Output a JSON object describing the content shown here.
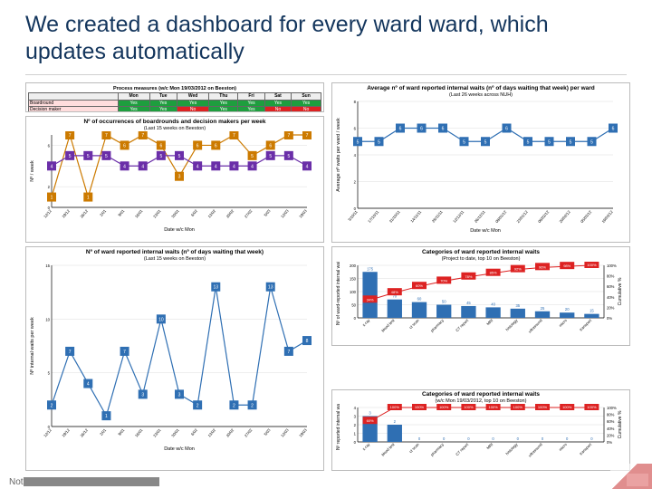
{
  "title": "We created a dashboard for every ward ward, which updates automatically",
  "table": {
    "title": "Process measures (w/c Mon 19/03/2012 on Beeston)",
    "days": [
      "Mon",
      "Tue",
      "Wed",
      "Thu",
      "Fri",
      "Sat",
      "Sun"
    ],
    "rows": [
      {
        "label": "Boardround",
        "values": [
          "Yes",
          "Yes",
          "Yes",
          "Yes",
          "Yes",
          "Yes",
          "Yes"
        ]
      },
      {
        "label": "Decision maker",
        "values": [
          "Yes",
          "Yes",
          "No",
          "Yes",
          "Yes",
          "No",
          "No"
        ]
      }
    ]
  },
  "line1": {
    "title": "Nº of occurrences of boardrounds and decision makers per week",
    "subtitle": "(Last 15 weeks on Beeston)",
    "yticks": [
      0,
      2,
      4,
      6
    ],
    "ymax": 7,
    "xlabel": "Date w/c Mon",
    "ylabel": "Nº / week",
    "x": [
      "12/12",
      "19/12",
      "26/12",
      "2/01",
      "9/01",
      "16/01",
      "23/01",
      "30/01",
      "6/02",
      "13/02",
      "20/02",
      "27/02",
      "5/03",
      "12/03",
      "19/03"
    ],
    "series": [
      {
        "name": "Boardrounds",
        "color": "#cc7a00",
        "values": [
          1,
          7,
          1,
          7,
          6,
          7,
          6,
          3,
          6,
          6,
          7,
          5,
          6,
          7,
          7
        ]
      },
      {
        "name": "Decision makers",
        "color": "#6a2ea8",
        "values": [
          4,
          5,
          5,
          5,
          4,
          4,
          5,
          5,
          4,
          4,
          4,
          4,
          5,
          5,
          4
        ]
      }
    ]
  },
  "line2": {
    "title": "Average nº of ward reported internal waits (nº of days waiting that week) per ward",
    "subtitle": "(Last 26 weeks across NUH)",
    "yticks": [
      0,
      2,
      4,
      6,
      8
    ],
    "ymax": 8,
    "xlabel": "Date w/c Mon",
    "ylabel": "Average nº waits per ward / week",
    "color": "#2f6fb3",
    "x": [
      "3/10/11",
      "17/10/11",
      "31/10/11",
      "14/11/11",
      "28/11/11",
      "12/12/11",
      "26/12/11",
      "09/01/12",
      "23/01/12",
      "06/02/12",
      "20/02/12",
      "05/03/12",
      "19/03/12"
    ],
    "values": [
      5,
      5,
      6,
      6,
      6,
      5,
      5,
      6,
      5,
      5,
      5,
      5,
      6
    ]
  },
  "line3": {
    "title": "Nº of ward reported internal waits (nº of days waiting that week)",
    "subtitle": "(Last 15 weeks on Beeston)",
    "yticks": [
      0,
      5,
      10,
      15
    ],
    "ymax": 15,
    "xlabel": "Date w/c Mon",
    "ylabel": "Nº internal waits per week",
    "color": "#2f6fb3",
    "x": [
      "12/12",
      "19/12",
      "26/12",
      "2/01",
      "9/01",
      "16/01",
      "23/01",
      "30/01",
      "6/02",
      "13/02",
      "20/02",
      "27/02",
      "5/03",
      "12/03",
      "19/03"
    ],
    "values": [
      2,
      7,
      4,
      1,
      7,
      3,
      10,
      3,
      2,
      13,
      2,
      2,
      13,
      7,
      8
    ]
  },
  "bar1": {
    "title": "Categories of ward reported internal waits",
    "subtitle": "(Project to date, top 10 on Beeston)",
    "xlabel": "",
    "ylabel_left": "Nº of ward-reported internal waits",
    "ylabel_right": "Cumulative %",
    "yticks_left": [
      0,
      50,
      100,
      150,
      200
    ],
    "yticks_right": [
      0,
      20,
      40,
      60,
      80,
      100
    ],
    "categories": [
      "x-ray",
      "blood test",
      "ct scan",
      "pharmacy",
      "CT report",
      "MRI",
      "histology",
      "ultrasound",
      "micro",
      "transport"
    ],
    "values": [
      175,
      70,
      60,
      50,
      45,
      40,
      35,
      25,
      20,
      15
    ],
    "cum_pct": [
      34,
      48,
      60,
      70,
      78,
      85,
      92,
      96,
      98,
      100
    ]
  },
  "bar2": {
    "title": "Categories of ward reported internal waits",
    "subtitle": "(w/c Mon 19/03/2012, top 10 on Beeston)",
    "ylabel_left": "Nº reported internal waits",
    "ylabel_right": "Cumulative %",
    "yticks_left": [
      0,
      1,
      2,
      3,
      4
    ],
    "yticks_right": [
      0,
      20,
      40,
      60,
      80,
      100
    ],
    "categories": [
      "x-ray",
      "blood test",
      "ct scan",
      "pharmacy",
      "CT report",
      "MRI",
      "histology",
      "ultrasound",
      "micro",
      "transport"
    ],
    "values": [
      3,
      2,
      0,
      0,
      0,
      0,
      0,
      0,
      0,
      0
    ],
    "cum_pct": [
      60,
      100,
      100,
      100,
      100,
      100,
      100,
      100,
      100,
      100
    ]
  },
  "footer": "Nottingham University Hospitals NHS Trust",
  "chart_data": [
    {
      "chart": "table",
      "title": "Process measures (w/c Mon 19/03/2012 on Beeston)",
      "days": [
        "Mon",
        "Tue",
        "Wed",
        "Thu",
        "Fri",
        "Sat",
        "Sun"
      ],
      "Boardround": [
        "Yes",
        "Yes",
        "Yes",
        "Yes",
        "Yes",
        "Yes",
        "Yes"
      ],
      "Decision maker": [
        "Yes",
        "Yes",
        "No",
        "Yes",
        "Yes",
        "No",
        "No"
      ]
    },
    {
      "chart": "line",
      "title": "Nº of occurrences of boardrounds and decision makers per week (Last 15 weeks on Beeston)",
      "xlabel": "Date w/c Mon",
      "ylabel": "Nº / week",
      "ylim": [
        0,
        7
      ],
      "x": [
        "12/12",
        "19/12",
        "26/12",
        "2/01",
        "9/01",
        "16/01",
        "23/01",
        "30/01",
        "6/02",
        "13/02",
        "20/02",
        "27/02",
        "5/03",
        "12/03",
        "19/03"
      ],
      "series": [
        {
          "name": "Boardrounds",
          "values": [
            1,
            7,
            1,
            7,
            6,
            7,
            6,
            3,
            6,
            6,
            7,
            5,
            6,
            7,
            7
          ]
        },
        {
          "name": "Decision makers",
          "values": [
            4,
            5,
            5,
            5,
            4,
            4,
            5,
            5,
            4,
            4,
            4,
            4,
            5,
            5,
            4
          ]
        }
      ]
    },
    {
      "chart": "line",
      "title": "Average nº of ward reported internal waits per ward (Last 26 weeks across NUH)",
      "xlabel": "Date w/c Mon",
      "ylabel": "Average nº waits per ward / week",
      "ylim": [
        0,
        8
      ],
      "x": [
        "3/10/11",
        "17/10/11",
        "31/10/11",
        "14/11/11",
        "28/11/11",
        "12/12/11",
        "26/12/11",
        "09/01/12",
        "23/01/12",
        "06/02/12",
        "20/02/12",
        "05/03/12",
        "19/03/12"
      ],
      "series": [
        {
          "name": "avg waits",
          "values": [
            5,
            5,
            6,
            6,
            6,
            5,
            5,
            6,
            5,
            5,
            5,
            5,
            6
          ]
        }
      ]
    },
    {
      "chart": "line",
      "title": "Nº of ward reported internal waits (Last 15 weeks on Beeston)",
      "xlabel": "Date w/c Mon",
      "ylabel": "Nº internal waits per week",
      "ylim": [
        0,
        15
      ],
      "x": [
        "12/12",
        "19/12",
        "26/12",
        "2/01",
        "9/01",
        "16/01",
        "23/01",
        "30/01",
        "6/02",
        "13/02",
        "20/02",
        "27/02",
        "5/03",
        "12/03",
        "19/03"
      ],
      "series": [
        {
          "name": "waits",
          "values": [
            2,
            7,
            4,
            1,
            7,
            3,
            10,
            3,
            2,
            13,
            2,
            2,
            13,
            7,
            8
          ]
        }
      ]
    },
    {
      "chart": "bar",
      "title": "Categories of ward reported internal waits (Project to date, top 10 on Beeston)",
      "xlabel": "",
      "ylabel": "Nº of ward-reported internal waits",
      "ylim": [
        0,
        200
      ],
      "categories": [
        "x-ray",
        "blood test",
        "ct scan",
        "pharmacy",
        "CT report",
        "MRI",
        "histology",
        "ultrasound",
        "micro",
        "transport"
      ],
      "series": [
        {
          "name": "count",
          "values": [
            175,
            70,
            60,
            50,
            45,
            40,
            35,
            25,
            20,
            15
          ]
        },
        {
          "name": "cumulative %",
          "values": [
            34,
            48,
            60,
            70,
            78,
            85,
            92,
            96,
            98,
            100
          ],
          "ylim": [
            0,
            100
          ]
        }
      ]
    },
    {
      "chart": "bar",
      "title": "Categories of ward reported internal waits (w/c Mon 19/03/2012, top 10 on Beeston)",
      "xlabel": "",
      "ylabel": "Nº reported internal waits",
      "ylim": [
        0,
        4
      ],
      "categories": [
        "x-ray",
        "blood test",
        "ct scan",
        "pharmacy",
        "CT report",
        "MRI",
        "histology",
        "ultrasound",
        "micro",
        "transport"
      ],
      "series": [
        {
          "name": "count",
          "values": [
            3,
            2,
            0,
            0,
            0,
            0,
            0,
            0,
            0,
            0
          ]
        },
        {
          "name": "cumulative %",
          "values": [
            60,
            100,
            100,
            100,
            100,
            100,
            100,
            100,
            100,
            100
          ],
          "ylim": [
            0,
            100
          ]
        }
      ]
    }
  ]
}
